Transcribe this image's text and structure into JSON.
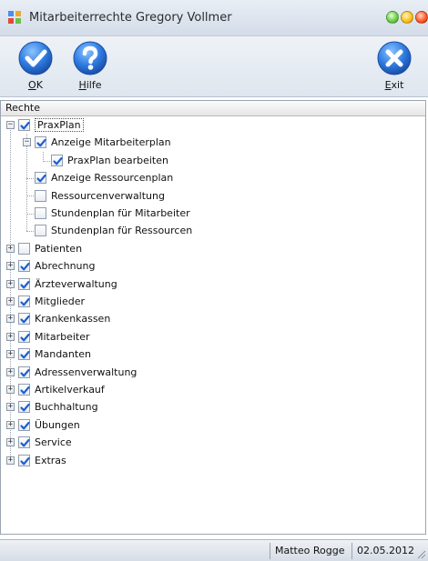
{
  "window": {
    "title": "Mitarbeiterrechte Gregory Vollmer"
  },
  "toolbar": {
    "ok_label_mnemonic": "O",
    "ok_label_rest": "K",
    "help_label_mnemonic": "H",
    "help_label_rest": "ilfe",
    "exit_label_mnemonic": "E",
    "exit_label_rest": "xit"
  },
  "tree": {
    "header": "Rechte",
    "items": [
      {
        "label": "PraxPlan",
        "checked": true,
        "level": 0,
        "expander": "minus",
        "selected": true
      },
      {
        "label": "Anzeige Mitarbeiterplan",
        "checked": true,
        "level": 1,
        "expander": "minus"
      },
      {
        "label": "PraxPlan bearbeiten",
        "checked": true,
        "level": 2,
        "expander": "none"
      },
      {
        "label": "Anzeige Ressourcenplan",
        "checked": true,
        "level": 1,
        "expander": "none"
      },
      {
        "label": "Ressourcenverwaltung",
        "checked": false,
        "level": 1,
        "expander": "none"
      },
      {
        "label": "Stundenplan für Mitarbeiter",
        "checked": false,
        "level": 1,
        "expander": "none"
      },
      {
        "label": "Stundenplan für Ressourcen",
        "checked": false,
        "level": 1,
        "expander": "none"
      },
      {
        "label": "Patienten",
        "checked": false,
        "level": 0,
        "expander": "plus"
      },
      {
        "label": "Abrechnung",
        "checked": true,
        "level": 0,
        "expander": "plus"
      },
      {
        "label": "Ärzteverwaltung",
        "checked": true,
        "level": 0,
        "expander": "plus"
      },
      {
        "label": "Mitglieder",
        "checked": true,
        "level": 0,
        "expander": "plus"
      },
      {
        "label": "Krankenkassen",
        "checked": true,
        "level": 0,
        "expander": "plus"
      },
      {
        "label": "Mitarbeiter",
        "checked": true,
        "level": 0,
        "expander": "plus"
      },
      {
        "label": "Mandanten",
        "checked": true,
        "level": 0,
        "expander": "plus"
      },
      {
        "label": "Adressenverwaltung",
        "checked": true,
        "level": 0,
        "expander": "plus"
      },
      {
        "label": "Artikelverkauf",
        "checked": true,
        "level": 0,
        "expander": "plus"
      },
      {
        "label": "Buchhaltung",
        "checked": true,
        "level": 0,
        "expander": "plus"
      },
      {
        "label": "Übungen",
        "checked": true,
        "level": 0,
        "expander": "plus"
      },
      {
        "label": "Service",
        "checked": true,
        "level": 0,
        "expander": "plus"
      },
      {
        "label": "Extras",
        "checked": true,
        "level": 0,
        "expander": "plus"
      }
    ]
  },
  "status": {
    "user": "Matteo Rogge",
    "date": "02.05.2012"
  },
  "colors": {
    "accent": "#2e7be0",
    "check": "#1d5fd0"
  },
  "icons": {
    "ok": "check-circle-icon",
    "help": "question-circle-icon",
    "exit": "x-circle-icon",
    "app": "grid-app-icon"
  }
}
